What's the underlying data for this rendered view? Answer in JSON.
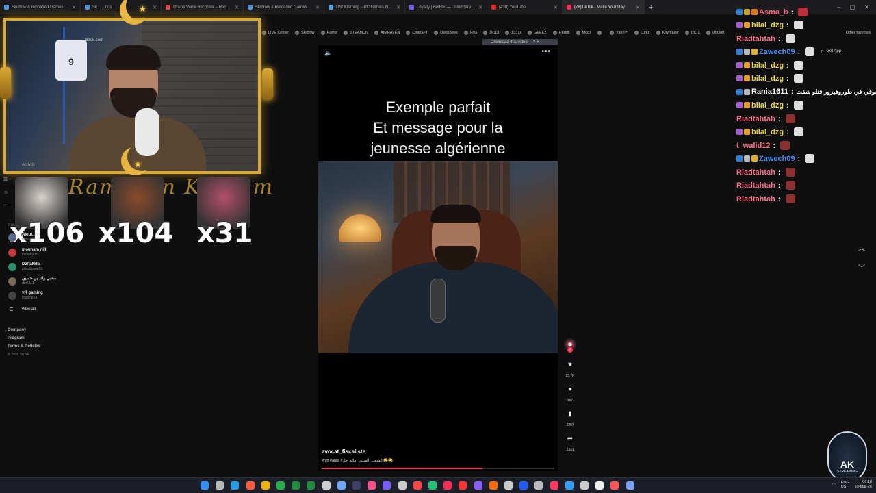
{
  "browser": {
    "tabs": [
      {
        "label": "Skidrow & Reloaded Games – Do",
        "icon_color": "#4a90d9"
      },
      {
        "label": "Sk... ...nds",
        "icon_color": "#4a90d9"
      },
      {
        "label": "Online Voice Recorder – Record Vo",
        "icon_color": "#e24a4a"
      },
      {
        "label": "Skidrow & Reloaded Games – Do",
        "icon_color": "#4a90d9"
      },
      {
        "label": "DSOGaming – PC Games News, Sa",
        "icon_color": "#5aa0e6"
      },
      {
        "label": "Loyalty | BotRix — Cloud Streami",
        "icon_color": "#7a5af0"
      },
      {
        "label": "(439) YouTube",
        "icon_color": "#ff2020"
      },
      {
        "label": "(78)TikTok - Make Your Day",
        "icon_color": "#fe2c55",
        "active": true
      }
    ],
    "new_tab": "+",
    "window_controls": [
      "–",
      "▢",
      "✕"
    ],
    "bookmarks": [
      "LIVE Center",
      "Skidrow",
      "Horror",
      "STEAMUN",
      "AIMHAVEN",
      "ChatGPT",
      "DeepSeek",
      "FitG",
      "DODI",
      "1337x",
      "GEEKZ",
      "Reddit",
      "Mods",
      "",
      "Yaeri™",
      "Lurkit",
      "Keymailer",
      "IBOX",
      "Ubisoft"
    ],
    "other_favorites": "Other favorites"
  },
  "webcam": {
    "site_text": "...tiktok.com",
    "jersey_number": "9"
  },
  "overlay": {
    "ramadan_text": "Ramadan Kareem",
    "alerts": [
      {
        "count": "x106",
        "image_color": "#d9d2cc"
      },
      {
        "count": "x104",
        "image_color": "#8a4a2a"
      },
      {
        "count": "x31",
        "image_color": "#b3506a"
      }
    ]
  },
  "tiktok": {
    "nav": {
      "activity": "Activity",
      "following_header": "Foll...",
      "following": [
        {
          "name": "Aloui...ilit",
          "handle": "aloui...",
          "color": "#5d6b8a"
        },
        {
          "name": "mounam nill",
          "handle": "insanitydzz",
          "color": "#c33a3a"
        },
        {
          "name": "DzPaNda",
          "handle": "pandazone53",
          "color": "#2f8f6a"
        },
        {
          "name": "محبي رائد بن حسين",
          "handle": "rfod.111",
          "color": "#7a6a5a"
        },
        {
          "name": "vR gaming",
          "handle": "vrgame19",
          "color": "#444444"
        }
      ],
      "view_all": "View all",
      "footer": [
        "Company",
        "Program",
        "Terms & Policies"
      ],
      "copyright": "© 2026 TikTok"
    },
    "video": {
      "caption_lines": [
        "Exemple parfait",
        "Et message pour la",
        "jeunesse algérienne"
      ],
      "author": "avocat_fiscaliste",
      "tags": "#typ #aura #الشعب_الصيني_ماله_حل 😂😂",
      "progress": 0.69,
      "download_label": "Download this video",
      "download_extra": "?  ✕"
    },
    "actions": {
      "likes": "23.7K",
      "comments": "167",
      "saves": "2297",
      "shares": "2331"
    },
    "get_app": "Get App"
  },
  "chat": [
    {
      "user": "Asma_b",
      "color": "#ff5f7a",
      "badges": [
        "#2f7fd6",
        "#c9a227",
        "#e07a20"
      ],
      "emote": "#c0303a",
      "text": ""
    },
    {
      "user": "bilal_dzg",
      "color": "#e7d33a",
      "badges": [
        "#a45fd0",
        "#e39e20"
      ],
      "emote": "#dddddd",
      "text": ""
    },
    {
      "user": "Riadtahtah",
      "color": "#ff6f8d",
      "badges": [],
      "emote": "#dddddd",
      "text": ""
    },
    {
      "user": "Zawech09",
      "color": "#3e8ef0",
      "badges": [
        "#2f7fd6",
        "#b8b8b8",
        "#e0b030"
      ],
      "emote": "#dddddd",
      "text": ""
    },
    {
      "user": "bilal_dzg",
      "color": "#e7d33a",
      "badges": [
        "#a45fd0",
        "#e39e20"
      ],
      "emote": "#dddddd",
      "text": ""
    },
    {
      "user": "bilal_dzg",
      "color": "#e7d33a",
      "badges": [
        "#a45fd0",
        "#e39e20"
      ],
      "emote": "#dddddd",
      "text": ""
    },
    {
      "user": "Rania1611",
      "color": "#ffffff",
      "badges": [
        "#2f7fd6",
        "#b8b8b8"
      ],
      "emote": "",
      "text": "خالي شوفي في طوروفيزور قتلو شفت"
    },
    {
      "user": "bilal_dzg",
      "color": "#e7d33a",
      "badges": [
        "#a45fd0",
        "#e39e20"
      ],
      "emote": "#dddddd",
      "text": ""
    },
    {
      "user": "Riadtahtah",
      "color": "#ff6f8d",
      "badges": [],
      "emote": "#8a3030",
      "text": ""
    },
    {
      "user": "bilal_dzg",
      "color": "#e7d33a",
      "badges": [
        "#a45fd0",
        "#e39e20"
      ],
      "emote": "#dddddd",
      "text": ""
    },
    {
      "user": "t_walid12",
      "color": "#ff6f8d",
      "badges": [],
      "emote": "#8a3030",
      "text": ""
    },
    {
      "user": "Zawech09",
      "color": "#3e8ef0",
      "badges": [
        "#2f7fd6",
        "#b8b8b8",
        "#e0b030"
      ],
      "emote": "#dddddd",
      "text": ""
    },
    {
      "user": "Riadtahtah",
      "color": "#ff6f8d",
      "badges": [],
      "emote": "#8a3030",
      "text": ""
    },
    {
      "user": "Riadtahtah",
      "color": "#ff6f8d",
      "badges": [],
      "emote": "#8a3030",
      "text": ""
    },
    {
      "user": "Riadtahtah",
      "color": "#ff6f8d",
      "badges": [],
      "emote": "#8a3030",
      "text": ""
    }
  ],
  "stream_logo": {
    "text": "AK",
    "sub": "STREAMING"
  },
  "taskbar": {
    "icon_colors": [
      "#2f8fff",
      "#bbbbbb",
      "#1fa0e8",
      "#ff5a3c",
      "#f0b400",
      "#22b04a",
      "#1e8c3c",
      "#1e8c3c",
      "#cfcfcf",
      "#6aa8ff",
      "#3a3f66",
      "#ff4f8b",
      "#7a5cff",
      "#cccccc",
      "#ff4444",
      "#22c070",
      "#ff2c55",
      "#ff3333",
      "#8a5cff",
      "#ff6a00",
      "#cccccc",
      "#1e5cff",
      "#bbbbbb",
      "#ff3a5c",
      "#2ea0ff",
      "#cccccc",
      "#eeeeee",
      "#ff5555",
      "#7aa0ff"
    ],
    "lang": "ENG\nUS",
    "time": "06:18",
    "date": "10-Mar-26"
  }
}
